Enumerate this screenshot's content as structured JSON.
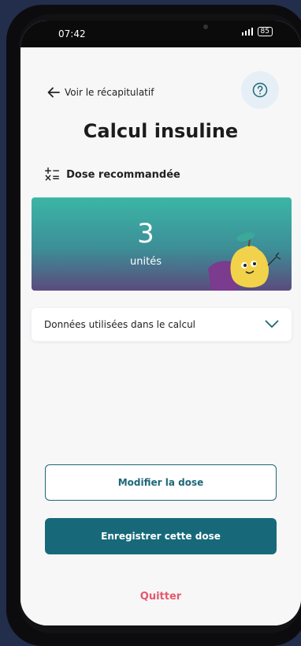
{
  "status_bar": {
    "time": "07:42",
    "battery": "85"
  },
  "header": {
    "back_label": "Voir le récapitulatif",
    "title": "Calcul insuline"
  },
  "dose_section": {
    "heading": "Dose recommandée"
  },
  "result": {
    "value": "3",
    "unit": "unités"
  },
  "data_panel": {
    "label": "Données utilisées dans le calcul"
  },
  "actions": {
    "modify_label": "Modifier la dose",
    "save_label": "Enregistrer cette dose",
    "quit_label": "Quitter"
  },
  "colors": {
    "primary": "#17697a",
    "accent_red": "#e35a6e",
    "gradient_top": "#3bb6a6",
    "gradient_bottom": "#5b4b7d"
  }
}
